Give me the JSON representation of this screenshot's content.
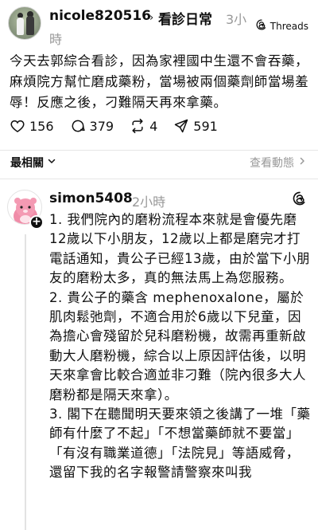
{
  "post": {
    "username": "nicole820516",
    "tag": "看診日常",
    "time_part1": "3小",
    "time_part2": "時",
    "badge": "Threads",
    "body": "今天去郭綜合看診，因為家裡國中生還不會吞藥，麻煩院方幫忙磨成藥粉，當場被兩個藥劑師當場羞辱！反應之後，刁難隔天再來拿藥。",
    "likes": "156",
    "comments": "379",
    "reposts": "4",
    "shares": "591"
  },
  "sort": {
    "label": "最相關",
    "activity": "查看動態"
  },
  "reply": {
    "username": "simon5408",
    "time": "2小時",
    "paragraphs": [
      "1. 我們院內的磨粉流程本來就是會優先磨12歲以下小朋友，12歲以上都是磨完才打電話通知，貴公子已經13歲，由於當下小朋友的磨粉太多，真的無法馬上為您服務。",
      "2. 貴公子的藥含 mephenoxalone，屬於肌肉鬆弛劑，不適合用於6歲以下兒童，因為擔心會殘留於兒科磨粉機，故需再重新啟動大人磨粉機，綜合以上原因評估後，以明天來拿會比較合適並非刁難（院內很多大人磨粉都是隔天來拿）。",
      "3. 閣下在聽聞明天要來領之後講了一堆「藥師有什麼了不起」「不想當藥師就不要當」「有沒有職業道德」「法院見」等語威脅，還留下我的名字報警請警察來叫我"
    ]
  },
  "icons": {
    "like": "heart-icon",
    "comment": "comment-icon",
    "repost": "repost-icon",
    "share": "send-icon",
    "threads": "threads-logo-icon",
    "chevron": "chevron-down-icon",
    "arrow": "chevron-right-icon"
  }
}
